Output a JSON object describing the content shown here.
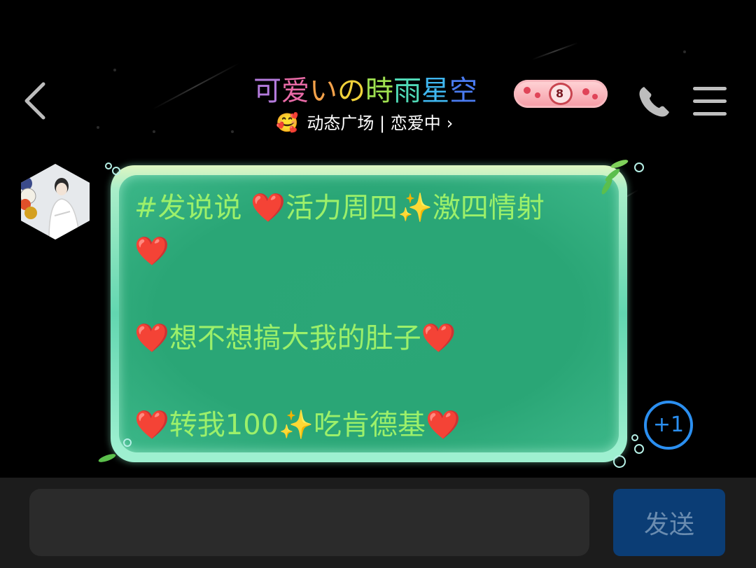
{
  "header": {
    "back_icon": "chevron-left-icon",
    "title_chars": [
      "可",
      "爱",
      "い",
      "の",
      "時",
      "雨",
      "星",
      "空"
    ],
    "badge_level": "8",
    "subtitle": "动态广场 | 恋爱中",
    "subtitle_emoji": "🥰",
    "subtitle_chevron": "›",
    "call_icon": "phone-icon",
    "menu_icon": "menu-icon"
  },
  "message": {
    "lines": [
      [
        "#发说说 ",
        "heart",
        "活力周四",
        "sparkle",
        "激四情射"
      ],
      [
        "heart"
      ],
      [],
      [
        "heart",
        "想不想搞大我的肚子",
        "heart"
      ],
      [],
      [
        "heart",
        "转我100",
        "sparkle",
        "吃肯德基",
        "heart"
      ]
    ],
    "heart": "❤️",
    "sparkle": "✨",
    "plus_one": "+1"
  },
  "composer": {
    "input_value": "",
    "input_placeholder": "",
    "send_label": "发送"
  },
  "colors": {
    "background": "#000000",
    "bubble_text": "#9cf06a",
    "plus_one": "#2b8ff0",
    "send_button": "#0b3d75",
    "send_text": "#6a8cb0"
  }
}
